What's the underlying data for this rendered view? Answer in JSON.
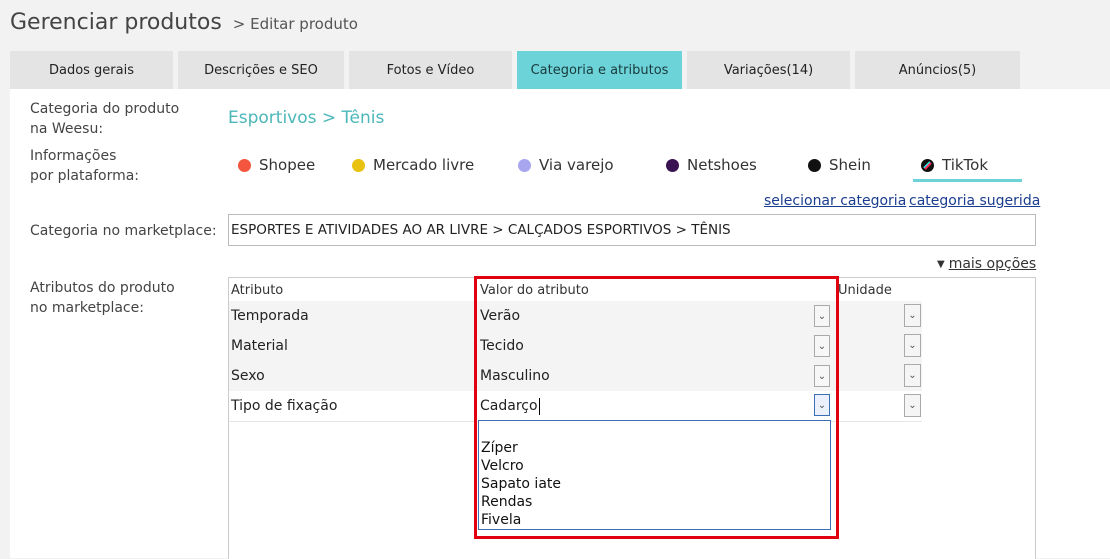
{
  "page": {
    "title": "Gerenciar produtos",
    "subtitle": "> Editar produto"
  },
  "tabs": [
    {
      "label": "Dados gerais"
    },
    {
      "label": "Descrições e SEO"
    },
    {
      "label": "Fotos e Vídeo"
    },
    {
      "label": "Categoria e atributos",
      "active": true
    },
    {
      "label": "Variações(14)"
    },
    {
      "label": "Anúncios(5)"
    }
  ],
  "form": {
    "category_label_1": "Categoria do produto",
    "category_label_2": "na Weesu:",
    "category_value": "Esportivos > Tênis",
    "platform_label_1": "Informações",
    "platform_label_2": "por plataforma:",
    "marketplace_label": "Categoria no marketplace:",
    "marketplace_value": "ESPORTES E ATIVIDADES AO AR LIVRE > CALÇADOS ESPORTIVOS > TÊNIS",
    "attributes_label_1": "Atributos do produto",
    "attributes_label_2": "no marketplace:"
  },
  "platforms": [
    {
      "name": "Shopee",
      "color": "#f4553d"
    },
    {
      "name": "Mercado livre",
      "color": "#e8c20f"
    },
    {
      "name": "Via varejo",
      "color": "#a8a6ee"
    },
    {
      "name": "Netshoes",
      "color": "#3a1252"
    },
    {
      "name": "Shein",
      "color": "#111111"
    },
    {
      "name": "TikTok",
      "color": "#111111",
      "selected": true
    }
  ],
  "links": {
    "select_category": "selecionar categoria",
    "suggested_category": "categoria sugerida",
    "more_options": "mais opções"
  },
  "table": {
    "headers": [
      "Atributo",
      "Valor do atributo",
      "Unidade"
    ],
    "rows": [
      {
        "attribute": "Temporada",
        "value": "Verão"
      },
      {
        "attribute": "Material",
        "value": "Tecido"
      },
      {
        "attribute": "Sexo",
        "value": "Masculino"
      },
      {
        "attribute": "Tipo de fixação",
        "value": "Cadarço"
      }
    ]
  },
  "dropdown": {
    "options": [
      "",
      "Zíper",
      "Velcro",
      "Sapato iate",
      "Rendas",
      "Fivela"
    ]
  },
  "colors": {
    "accent": "#6cd3d9",
    "link": "#1a3d8f",
    "highlight": "#e0000f"
  }
}
